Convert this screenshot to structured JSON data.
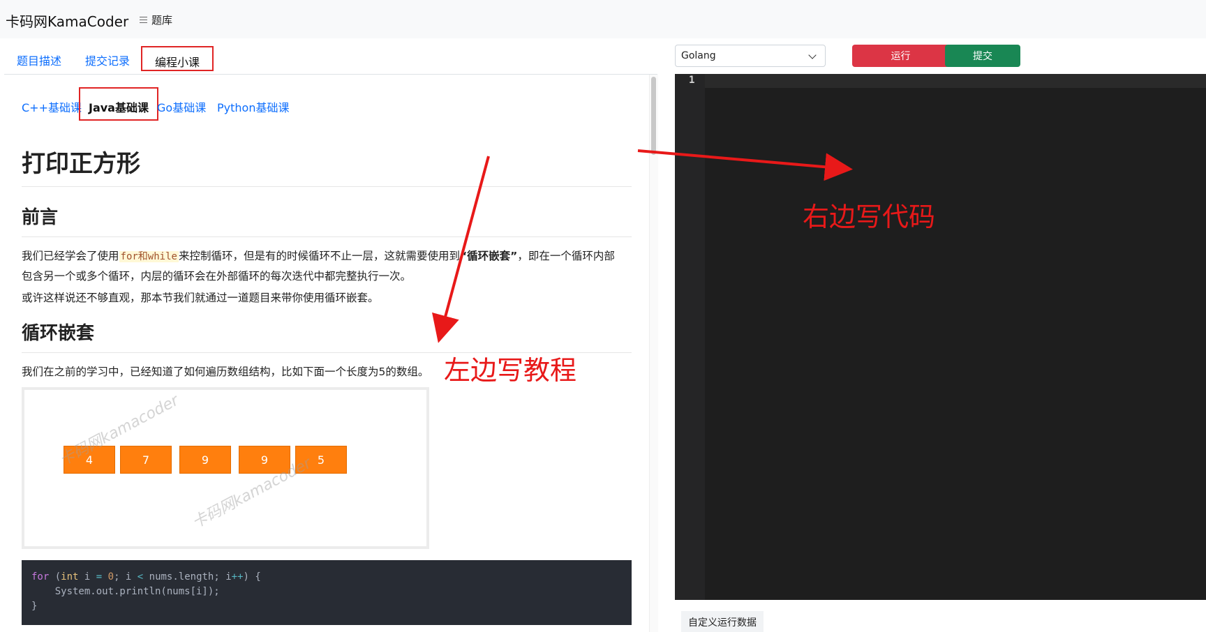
{
  "header": {
    "brand": "卡码网KamaCoder",
    "nav_tiku": "题库"
  },
  "left_tabs": [
    {
      "label": "题目描述",
      "active": false
    },
    {
      "label": "提交记录",
      "active": false
    },
    {
      "label": "编程小课",
      "active": true
    }
  ],
  "subtabs": [
    {
      "label": "C++基础课",
      "active": false
    },
    {
      "label": "Java基础课",
      "active": true
    },
    {
      "label": "Go基础课",
      "active": false
    },
    {
      "label": "Python基础课",
      "active": false
    }
  ],
  "article": {
    "title": "打印正方形",
    "section1": "前言",
    "p1_a": "我们已经学会了使用",
    "p1_code": "for和while",
    "p1_b": "来控制循环，但是有的时候循环不止一层，这就需要使用到",
    "p1_bold": "“循环嵌套”",
    "p1_c": "，即在一个循环内部",
    "p1_line2": "包含另一个或多个循环，内层的循环会在外部循环的每次迭代中都完整执行一次。",
    "p2": "或许这样说还不够直观，那本节我们就通过一道题目来带你使用循环嵌套。",
    "section2": "循环嵌套",
    "p3": "我们在之前的学习中，已经知道了如何遍历数组结构，比如下面一个长度为5的数组。",
    "array_values": [
      "4",
      "7",
      "9",
      "9",
      "5"
    ],
    "watermark": "卡码网kamacoder",
    "code_lines": [
      "for (int i = 0; i < nums.length; i++) {",
      "    System.out.println(nums[i]);",
      "}"
    ]
  },
  "editor": {
    "language": "Golang",
    "run_label": "运行",
    "submit_label": "提交",
    "line_number": "1",
    "custom_data_label": "自定义运行数据"
  },
  "annotations": {
    "right": "右边写代码",
    "left": "左边写教程"
  },
  "colors": {
    "accent_link": "#0d6efd",
    "annotation_red": "#e81919",
    "run": "#dc3545",
    "submit": "#198754",
    "array_cell": "#ff7f0e"
  }
}
